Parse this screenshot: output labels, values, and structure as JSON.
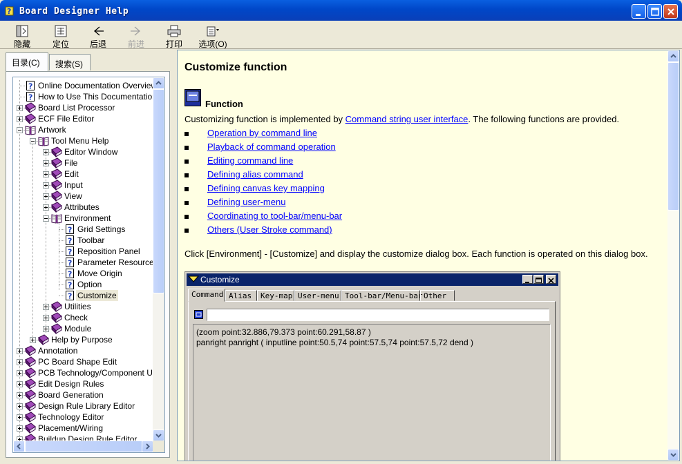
{
  "window": {
    "title": "Board Designer Help"
  },
  "toolbar": [
    {
      "name": "hide-button",
      "icon": "hide-icon",
      "label": "隐藏",
      "enabled": true
    },
    {
      "name": "locate-button",
      "icon": "locate-icon",
      "label": "定位",
      "enabled": true
    },
    {
      "name": "back-button",
      "icon": "back-arrow-icon",
      "label": "后退",
      "enabled": true
    },
    {
      "name": "forward-button",
      "icon": "forward-arrow-icon",
      "label": "前进",
      "enabled": false
    },
    {
      "name": "print-button",
      "icon": "printer-icon",
      "label": "打印",
      "enabled": true
    },
    {
      "name": "options-button",
      "icon": "options-icon",
      "label": "选项(O)",
      "enabled": true
    }
  ],
  "nav": {
    "tabs": [
      {
        "label": "目录(C)",
        "active": true
      },
      {
        "label": "搜索(S)",
        "active": false
      }
    ],
    "tree": [
      {
        "label": "Online Documentation Overview",
        "type": "page",
        "level": 0
      },
      {
        "label": "How to Use This Documentation",
        "type": "page",
        "level": 0
      },
      {
        "label": "Board List Processor",
        "type": "book",
        "level": 0,
        "expander": "plus"
      },
      {
        "label": "ECF File Editor",
        "type": "book",
        "level": 0,
        "expander": "plus"
      },
      {
        "label": "Artwork",
        "type": "open-book",
        "level": 0,
        "expander": "minus"
      },
      {
        "label": "Tool Menu Help",
        "type": "open-book",
        "level": 1,
        "expander": "minus"
      },
      {
        "label": "Editor Window",
        "type": "book",
        "level": 2,
        "expander": "plus"
      },
      {
        "label": "File",
        "type": "book",
        "level": 2,
        "expander": "plus"
      },
      {
        "label": "Edit",
        "type": "book",
        "level": 2,
        "expander": "plus"
      },
      {
        "label": "Input",
        "type": "book",
        "level": 2,
        "expander": "plus"
      },
      {
        "label": "View",
        "type": "book",
        "level": 2,
        "expander": "plus"
      },
      {
        "label": "Attributes",
        "type": "book",
        "level": 2,
        "expander": "plus"
      },
      {
        "label": "Environment",
        "type": "open-book",
        "level": 2,
        "expander": "minus"
      },
      {
        "label": "Grid Settings",
        "type": "page",
        "level": 3
      },
      {
        "label": "Toolbar",
        "type": "page",
        "level": 3
      },
      {
        "label": "Reposition Panel",
        "type": "page",
        "level": 3
      },
      {
        "label": "Parameter Resource",
        "type": "page",
        "level": 3
      },
      {
        "label": "Move Origin",
        "type": "page",
        "level": 3
      },
      {
        "label": "Option",
        "type": "page",
        "level": 3
      },
      {
        "label": "Customize",
        "type": "page",
        "level": 3,
        "selected": true
      },
      {
        "label": "Utilities",
        "type": "book",
        "level": 2,
        "expander": "plus"
      },
      {
        "label": "Check",
        "type": "book",
        "level": 2,
        "expander": "plus"
      },
      {
        "label": "Module",
        "type": "book",
        "level": 2,
        "expander": "plus"
      },
      {
        "label": "Help by Purpose",
        "type": "book",
        "level": 1,
        "expander": "plus"
      },
      {
        "label": "Annotation",
        "type": "book",
        "level": 0,
        "expander": "plus"
      },
      {
        "label": "PC Board Shape Edit",
        "type": "book",
        "level": 0,
        "expander": "plus"
      },
      {
        "label": "PCB Technology/Component Upd",
        "type": "book",
        "level": 0,
        "expander": "plus"
      },
      {
        "label": "Edit Design Rules",
        "type": "book",
        "level": 0,
        "expander": "plus"
      },
      {
        "label": "Board Generation",
        "type": "book",
        "level": 0,
        "expander": "plus"
      },
      {
        "label": "Design Rule Library Editor",
        "type": "book",
        "level": 0,
        "expander": "plus"
      },
      {
        "label": "Technology Editor",
        "type": "book",
        "level": 0,
        "expander": "plus"
      },
      {
        "label": "Placement/Wiring",
        "type": "book",
        "level": 0,
        "expander": "plus"
      },
      {
        "label": "Buildup Design Rule Editor",
        "type": "book",
        "level": 0,
        "expander": "plus"
      }
    ]
  },
  "content": {
    "heading": "Customize function",
    "section_title": "Function",
    "intro_before": "Customizing function is implemented by ",
    "intro_link": "Command string user interface",
    "intro_after": ". The following functions are provided.",
    "links": [
      "Operation by command line",
      "Playback of command operation",
      "Editing command line",
      "Defining alias command",
      "Defining canvas key mapping",
      "Defining user-menu",
      "Coordinating to tool-bar/menu-bar",
      "Others (User Stroke command)"
    ],
    "instruction": "Click [Environment] - [Customize] and display the customize dialog box. Each function is operated on this dialog box.",
    "dialog": {
      "title": "Customize",
      "tabs": [
        "Command",
        "Alias",
        "Key-map",
        "User-menu",
        "Tool-bar/Menu-bar",
        "Other"
      ],
      "lines": [
        "(zoom point:32.886,79.373 point:60.291,58.87 )",
        "panright panright ( inputline point:50.5,74 point:57.5,74 point:57.5,72 dend )"
      ]
    }
  },
  "colors": {
    "content_bg": "#ffffe3",
    "link": "#0000ff",
    "book_purple": "#7b2a8c",
    "titlebar": "#0047c8"
  }
}
